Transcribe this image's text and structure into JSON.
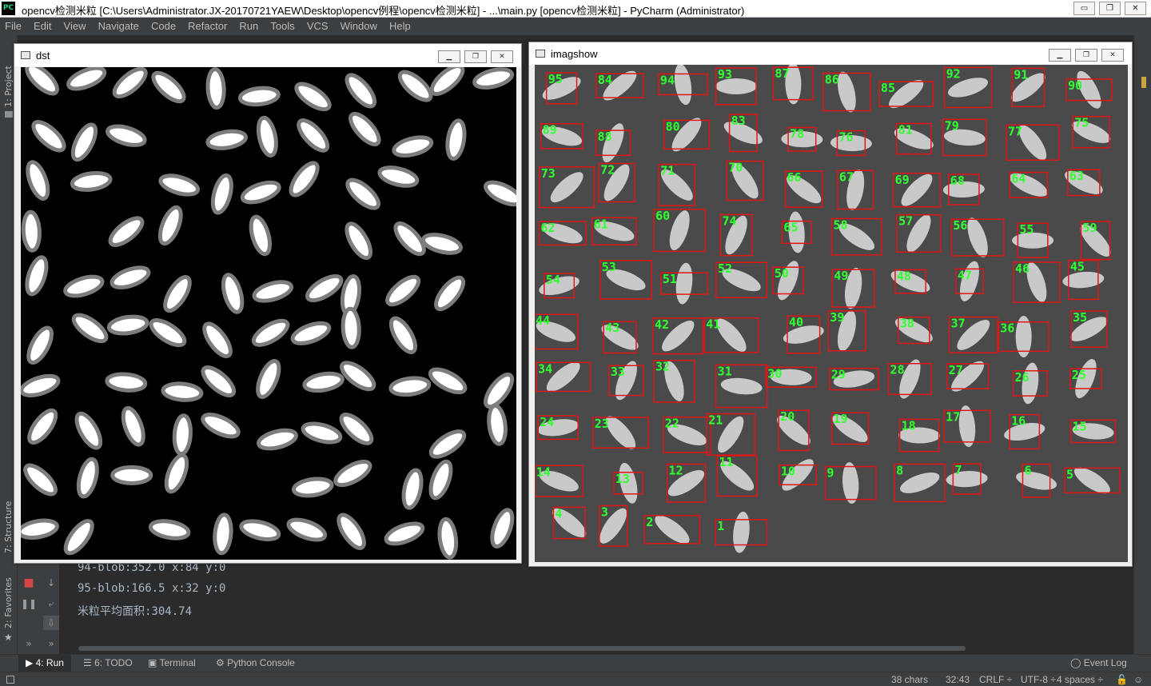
{
  "app": {
    "logo_text": "PC",
    "title": "opencv检测米粒 [C:\\Users\\Administrator.JX-20170721YAEW\\Desktop\\opencv例程\\opencv检测米粒] - ...\\main.py [opencv检测米粒] - PyCharm (Administrator)"
  },
  "title_buttons": {
    "minimize": "▭",
    "restore": "❐",
    "close": "✕"
  },
  "menu": [
    {
      "label": "File"
    },
    {
      "label": "Edit"
    },
    {
      "label": "View"
    },
    {
      "label": "Navigate"
    },
    {
      "label": "Code"
    },
    {
      "label": "Refactor"
    },
    {
      "label": "Run"
    },
    {
      "label": "Tools"
    },
    {
      "label": "VCS"
    },
    {
      "label": "Window"
    },
    {
      "label": "Help"
    }
  ],
  "side_tabs": {
    "project": "1: Project",
    "structure": "7: Structure",
    "favorites": "2: Favorites"
  },
  "windows": {
    "dst": {
      "title": "dst"
    },
    "imagshow": {
      "title": "imagshow"
    }
  },
  "console": {
    "lines": [
      "94-blob:352.0  x:84 y:0",
      "95-blob:166.5  x:32 y:0",
      "米粒平均面积:304.74"
    ]
  },
  "bottom_tabs": {
    "run": "4: Run",
    "todo": "6: TODO",
    "terminal": "Terminal",
    "python_console": "Python Console",
    "event_log": "Event Log"
  },
  "status": {
    "chars": "38 chars",
    "position": "32:43",
    "line_sep": "CRLF ÷",
    "encoding": "UTF-8 ÷",
    "indent": "4 spaces ÷"
  },
  "colors": {
    "label_green": "#30ff30",
    "box_red": "#e01515",
    "ide_bg": "#3c3f41",
    "console_bg": "#2b2b2b"
  },
  "rice_labels": [
    "95",
    "84",
    "94",
    "93",
    "87",
    "86",
    "85",
    "92",
    "91",
    "90",
    "89",
    "88",
    "80",
    "83",
    "78",
    "76",
    "81",
    "79",
    "77",
    "75",
    "73",
    "72",
    "71",
    "70",
    "66",
    "67",
    "69",
    "68",
    "64",
    "63",
    "62",
    "61",
    "60",
    "74",
    "65",
    "58",
    "57",
    "56",
    "55",
    "59",
    "54",
    "53",
    "51",
    "52",
    "50",
    "49",
    "48",
    "47",
    "46",
    "45",
    "44",
    "43",
    "42",
    "41",
    "40",
    "39",
    "38",
    "37",
    "36",
    "35",
    "34",
    "33",
    "32",
    "31",
    "30",
    "29",
    "28",
    "27",
    "26",
    "25",
    "24",
    "23",
    "22",
    "21",
    "20",
    "19",
    "18",
    "17",
    "16",
    "15",
    "14",
    "13",
    "12",
    "11",
    "10",
    "9",
    "8",
    "7",
    "6",
    "5",
    "4",
    "3",
    "2",
    "1"
  ]
}
